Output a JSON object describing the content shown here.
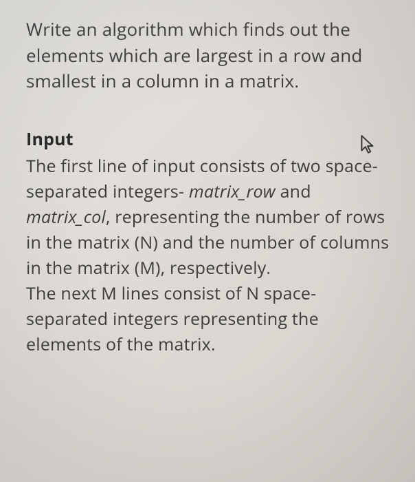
{
  "problem": {
    "statement": "Write an algorithm which finds out the elements which are largest in a row and smallest in a column in a matrix."
  },
  "input_section": {
    "heading": "Input",
    "line1_part1": "The first line of input consists of two space-separated integers- ",
    "var1": "matrix_row",
    "line1_part2": " and ",
    "var2": "matrix_col",
    "line1_part3": ", representing the number of rows in the matrix (N) and the number of columns in the matrix (M), respectively.",
    "line2": "The next M lines consist of N space-separated integers representing the elements of the matrix."
  }
}
